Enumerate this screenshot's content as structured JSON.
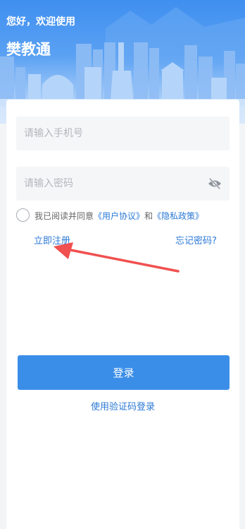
{
  "header": {
    "greeting": "您好，欢迎使用",
    "app_name": "樊教通"
  },
  "login_form": {
    "phone_placeholder": "请输入手机号",
    "password_placeholder": "请输入密码",
    "agreement": {
      "prefix": "我已阅读并同意",
      "user_agreement": "《用户协议》",
      "conjunction": "和",
      "privacy_policy": "《隐私政策》"
    },
    "register_link": "立即注册",
    "forgot_password_link": "忘记密码?",
    "login_button": "登录",
    "code_login_link": "使用验证码登录"
  },
  "colors": {
    "accent": "#3a8ee8",
    "link": "#2b79d6",
    "annotation_arrow": "#f0504f"
  },
  "icons": {
    "password_visibility": "eye-off-icon"
  }
}
